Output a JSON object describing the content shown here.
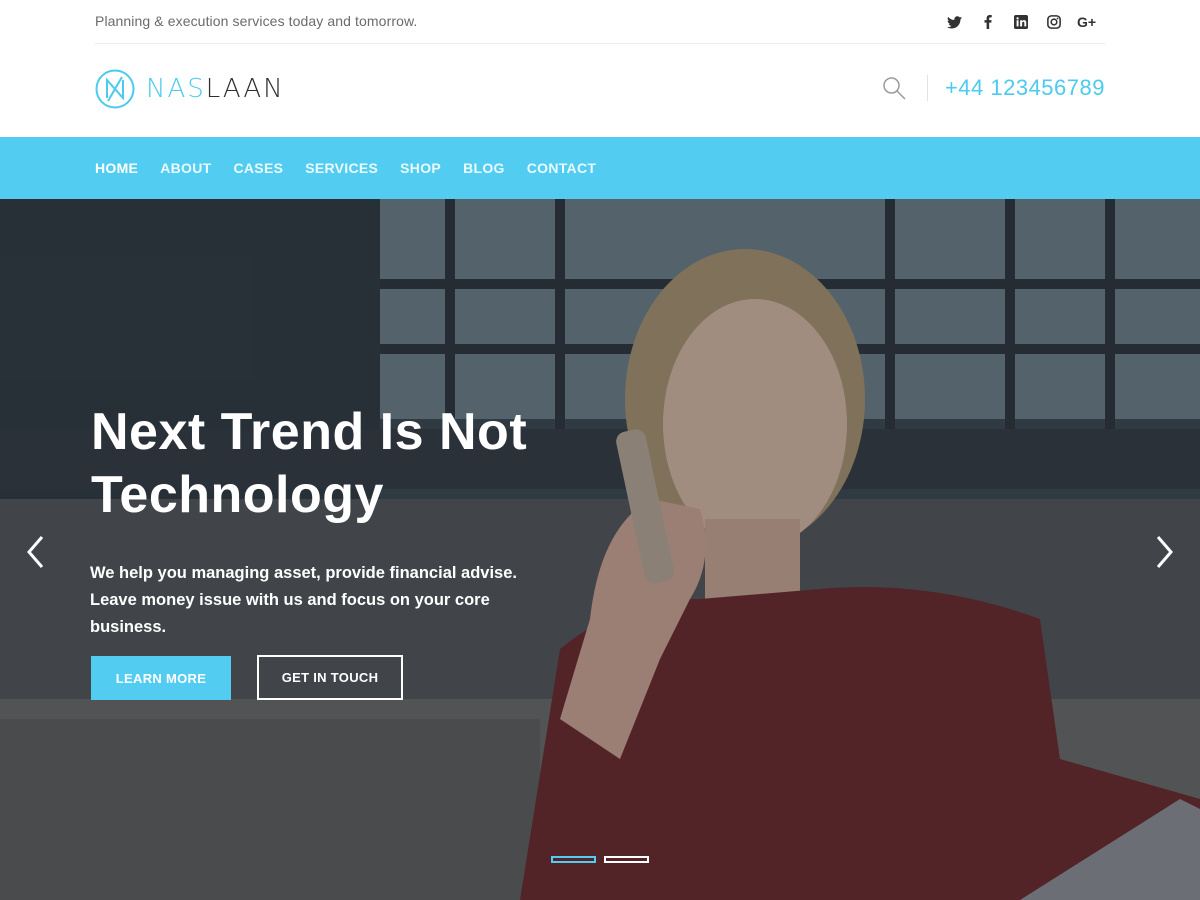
{
  "topbar": {
    "tagline": "Planning & execution services today and tomorrow.",
    "social_icons": [
      "twitter-icon",
      "facebook-icon",
      "linkedin-icon",
      "instagram-icon",
      "google-plus-icon"
    ],
    "google_plus_label": "G+"
  },
  "header": {
    "logo_text_accent": "NAS",
    "logo_text_rest": "LAAN",
    "phone": "+44 123456789"
  },
  "nav": {
    "items": [
      "HOME",
      "ABOUT",
      "CASES",
      "SERVICES",
      "SHOP",
      "BLOG",
      "CONTACT"
    ],
    "active": "HOME"
  },
  "hero": {
    "headline_line1": "Next Trend Is Not",
    "headline_line2": "Technology",
    "subtext": "We help you managing asset, provide financial advise. Leave money issue with us and focus on your core business.",
    "primary_button": "LEARN MORE",
    "secondary_button": "GET IN TOUCH",
    "slide_count": 2,
    "active_slide": 1
  },
  "colors": {
    "accent": "#52cdf1",
    "text_dark": "#2f2f2f",
    "text_muted": "#6b6b6b"
  }
}
